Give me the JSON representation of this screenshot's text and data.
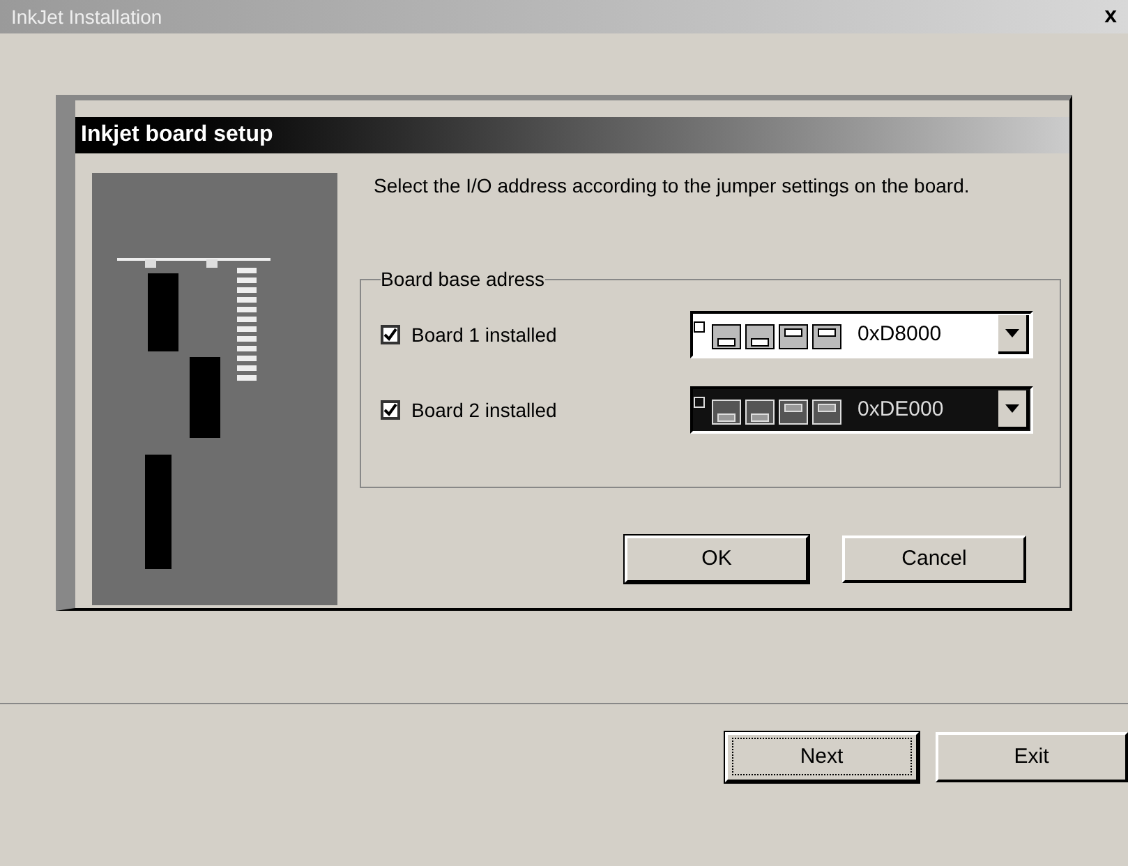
{
  "window": {
    "title": "InkJet Installation",
    "close": "x"
  },
  "dialog": {
    "title": "Inkjet board setup",
    "instruction": "Select the I/O address according to the jumper settings on the board.",
    "group": {
      "title": "Board base adress",
      "boards": [
        {
          "label": "Board 1 installed",
          "checked": true,
          "address": "0xD8000",
          "selected": false
        },
        {
          "label": "Board 2 installed",
          "checked": true,
          "address": "0xDE000",
          "selected": true
        }
      ]
    },
    "buttons": [
      {
        "label": "OK",
        "default": true
      },
      {
        "label": "Cancel",
        "default": false
      }
    ]
  },
  "footer_buttons": [
    {
      "label": "Next",
      "default": true
    },
    {
      "label": "Exit",
      "default": false
    }
  ]
}
